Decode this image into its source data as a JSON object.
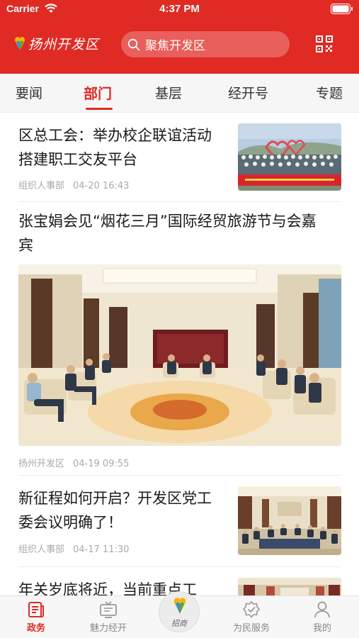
{
  "status_bar": {
    "carrier": "Carrier",
    "time": "4:37 PM"
  },
  "header": {
    "brand": "扬州开发区",
    "search_placeholder": "聚焦开发区",
    "accent": "#e02a24"
  },
  "tabs": [
    {
      "label": "要闻",
      "active": false
    },
    {
      "label": "部门",
      "active": true
    },
    {
      "label": "基层",
      "active": false
    },
    {
      "label": "经开号",
      "active": false
    },
    {
      "label": "专题",
      "active": false
    }
  ],
  "articles": [
    {
      "title": "区总工会：举办校企联谊活动 搭建职工交友平台",
      "source": "组织人事部",
      "time": "04-20 16:43"
    },
    {
      "title": "张宝娟会见“烟花三月”国际经贸旅游节与会嘉宾",
      "source": "扬州开发区",
      "time": "04-19 09:55"
    },
    {
      "title": "新征程如何开启？开发区党工委会议明确了！",
      "source": "组织人事部",
      "time": "04-17 11:30"
    },
    {
      "title": "年关岁底将近，当前重点工",
      "source": "",
      "time": ""
    }
  ],
  "bottom_nav": [
    {
      "label": "政务",
      "icon": "news-icon",
      "active": true
    },
    {
      "label": "魅力经开",
      "icon": "tv-icon",
      "active": false
    },
    {
      "label": "招商",
      "icon": "logo-icon",
      "active": false
    },
    {
      "label": "为民服务",
      "icon": "badge-check-icon",
      "active": false
    },
    {
      "label": "我的",
      "icon": "person-icon",
      "active": false
    }
  ]
}
